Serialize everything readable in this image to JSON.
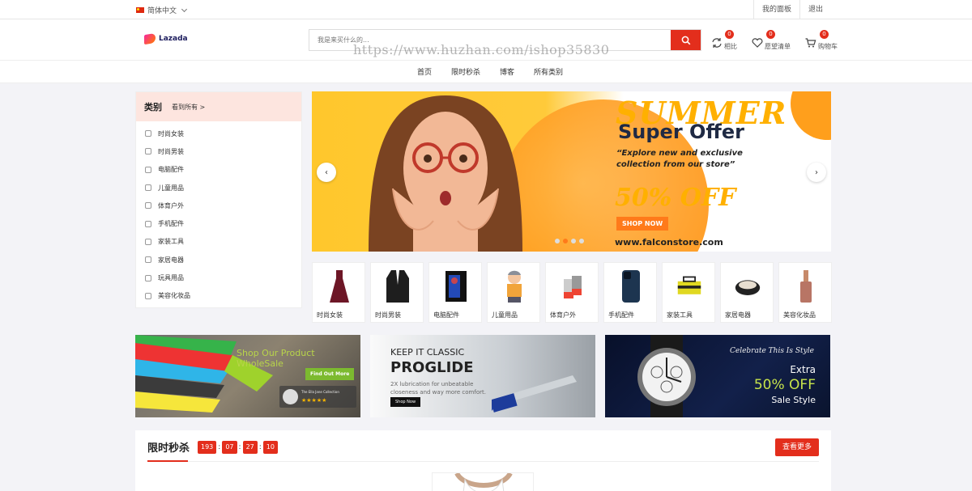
{
  "topbar": {
    "language": "简体中文",
    "links": [
      "我的面板",
      "退出"
    ]
  },
  "header": {
    "logo_text": "Lazada",
    "search": {
      "placeholder": "我是来买什么的..."
    },
    "watermark": "https://www.huzhan.com/ishop35830",
    "icons": [
      {
        "name": "compare",
        "label": "相比",
        "count": "0"
      },
      {
        "name": "wishlist",
        "label": "愿望清单",
        "count": "0"
      },
      {
        "name": "cart",
        "label": "购物车",
        "count": "0"
      }
    ]
  },
  "nav": [
    "首页",
    "限时秒杀",
    "博客",
    "所有类别"
  ],
  "categories": {
    "title": "类别",
    "see_all": "看到所有 >",
    "items": [
      "时尚女装",
      "时尚男装",
      "电脑配件",
      "儿童用品",
      "体育户外",
      "手机配件",
      "家装工具",
      "家居电器",
      "玩具用品",
      "美容化妆品"
    ]
  },
  "banner": {
    "headline": "SUMMER",
    "subheadline": "Super Offer",
    "description": "“Explore new and exclusive collection from our store”",
    "discount": "50% OFF",
    "cta": "SHOP NOW",
    "url": "www.falconstore.com",
    "slides": 4,
    "active_slide": 2
  },
  "products": [
    "时尚女装",
    "时尚男装",
    "电脑配件",
    "儿童用品",
    "体育户外",
    "手机配件",
    "家装工具",
    "家居电器",
    "美容化妆品"
  ],
  "promos": [
    {
      "title": "Shop Our Product WholeSale",
      "cta": "Find Out More",
      "caption": "The Ella Jane Collection"
    },
    {
      "kicker": "KEEP IT CLASSIC",
      "title": "PROGLIDE",
      "text": "2X lubrication for unbeatable closeness and way more comfort.",
      "cta": "Shop Now"
    },
    {
      "script": "Celebrate This Is Style",
      "line1": "Extra",
      "line2": "50% OFF",
      "line3": "Sale Style"
    }
  ],
  "flash_sale": {
    "title": "限时秒杀",
    "timer": [
      "193",
      "07",
      "27",
      "10"
    ],
    "more": "查看更多"
  },
  "colors": {
    "accent": "#e32e1c",
    "banner_orange": "#ffb000"
  }
}
